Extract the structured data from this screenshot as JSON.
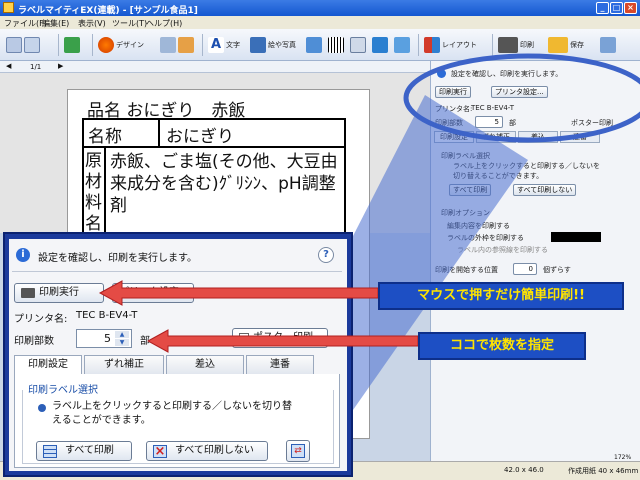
{
  "window": {
    "title": "ラベルマイティEX(連載) - [サンプル食品1]"
  },
  "menu": [
    "ファイル(F)",
    "編集(E)",
    "表示(V)",
    "ツール(T)",
    "ヘルプ(H)"
  ],
  "toolbar": {
    "design": "デザイン",
    "text": "文字",
    "picture": "絵や写真",
    "layout": "レイアウト",
    "print": "印刷",
    "save": "保存"
  },
  "page_indicator": "1/1",
  "label": {
    "title": "品名 おにぎり　赤飯",
    "name_key": "名称",
    "name_value": "おにぎり",
    "ingredients_key": "原材料名",
    "ingredients_value": "赤飯、ごま塩(その他、大豆由来成分を含む)ｸﾞﾘｼﾝ、pH調整剤"
  },
  "print_panel": {
    "info": "設定を確認し、印刷を実行します。",
    "print_button": "印刷実行",
    "printer_settings_button": "プリンタ設定...",
    "printer_label": "プリンタ名:",
    "printer_name": "TEC B-EV4-T",
    "copies_label": "印刷部数",
    "copies_value": "5",
    "copies_unit": "部",
    "poster_label": "ポスター印刷",
    "tabs": [
      "印刷設定",
      "ずれ補正",
      "差込",
      "連番"
    ],
    "group_title": "印刷ラベル選択",
    "group_desc": "ラベル上をクリックすると印刷する／しないを切り替えることができます。",
    "print_all": "すべて印刷",
    "print_none": "すべて印刷しない",
    "options_title": "印刷オプション",
    "option_edit": "編集内容を印刷する",
    "option_frame": "ラベルの外枠を印刷する",
    "option_ref": "ラベル内の参照線を印刷する",
    "start_pos": "印刷を開始する位置",
    "start_value": "0",
    "shift_unit": "個ずらす"
  },
  "callouts": {
    "one_click": "マウスで押すだけ簡単印刷!!",
    "copies": "ココで枚数を指定"
  },
  "status": {
    "size": "42.0 x 46.0",
    "paper": "作成用紙 40 x 46mm",
    "zoom": "172%"
  },
  "colors": {
    "callout_bg": "#1d4fc4",
    "callout_text": "#ffe400",
    "arrow": "#e03a3a"
  }
}
